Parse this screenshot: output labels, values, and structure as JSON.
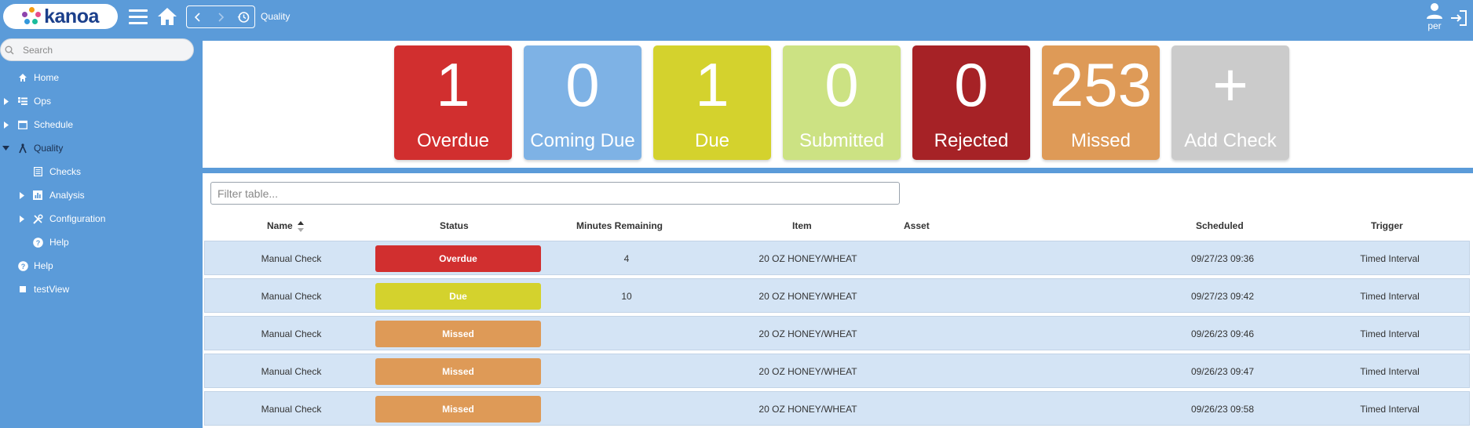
{
  "app": {
    "logo_text": "kanoa",
    "breadcrumb": "Quality",
    "user": "per"
  },
  "sidebar": {
    "search_placeholder": "Search",
    "items": [
      {
        "label": "Home",
        "icon": "home-icon"
      },
      {
        "label": "Ops",
        "icon": "list-icon",
        "expandable": true
      },
      {
        "label": "Schedule",
        "icon": "calendar-icon",
        "expandable": true
      },
      {
        "label": "Quality",
        "icon": "compass-icon",
        "expanded": true
      },
      {
        "label": "Checks",
        "icon": "document-icon"
      },
      {
        "label": "Analysis",
        "icon": "chart-icon",
        "expandable": true
      },
      {
        "label": "Configuration",
        "icon": "tools-icon",
        "expandable": true
      },
      {
        "label": "Help",
        "icon": "help-icon"
      },
      {
        "label": "Help",
        "icon": "help-icon"
      },
      {
        "label": "testView",
        "icon": "square-icon"
      }
    ]
  },
  "tiles": [
    {
      "count": "1",
      "label": "Overdue",
      "color": "#d12f2f"
    },
    {
      "count": "0",
      "label": "Coming Due",
      "color": "#7eb2e5"
    },
    {
      "count": "1",
      "label": "Due",
      "color": "#d4d22d"
    },
    {
      "count": "0",
      "label": "Submitted",
      "color": "#cce283"
    },
    {
      "count": "0",
      "label": "Rejected",
      "color": "#a62226"
    },
    {
      "count": "253",
      "label": "Missed",
      "color": "#de9a57"
    },
    {
      "count": "+",
      "label": "Add Check",
      "color": "#cbcbcb"
    }
  ],
  "table": {
    "filter_placeholder": "Filter table...",
    "columns": [
      "Name",
      "Status",
      "Minutes Remaining",
      "Item",
      "Asset",
      "Scheduled",
      "Trigger"
    ],
    "rows": [
      {
        "name": "Manual Check",
        "status": "Overdue",
        "status_color": "#d12f2f",
        "minutes": "4",
        "item": "20 OZ HONEY/WHEAT",
        "asset": "",
        "scheduled": "09/27/23 09:36",
        "trigger": "Timed Interval"
      },
      {
        "name": "Manual Check",
        "status": "Due",
        "status_color": "#d4d22d",
        "minutes": "10",
        "item": "20 OZ HONEY/WHEAT",
        "asset": "",
        "scheduled": "09/27/23 09:42",
        "trigger": "Timed Interval"
      },
      {
        "name": "Manual Check",
        "status": "Missed",
        "status_color": "#de9a57",
        "minutes": "",
        "item": "20 OZ HONEY/WHEAT",
        "asset": "",
        "scheduled": "09/26/23 09:46",
        "trigger": "Timed Interval"
      },
      {
        "name": "Manual Check",
        "status": "Missed",
        "status_color": "#de9a57",
        "minutes": "",
        "item": "20 OZ HONEY/WHEAT",
        "asset": "",
        "scheduled": "09/26/23 09:47",
        "trigger": "Timed Interval"
      },
      {
        "name": "Manual Check",
        "status": "Missed",
        "status_color": "#de9a57",
        "minutes": "",
        "item": "20 OZ HONEY/WHEAT",
        "asset": "",
        "scheduled": "09/26/23 09:58",
        "trigger": "Timed Interval"
      }
    ]
  },
  "colors": {
    "header_bg": "#5b9bd9",
    "row_bg": "#d4e4f5"
  }
}
